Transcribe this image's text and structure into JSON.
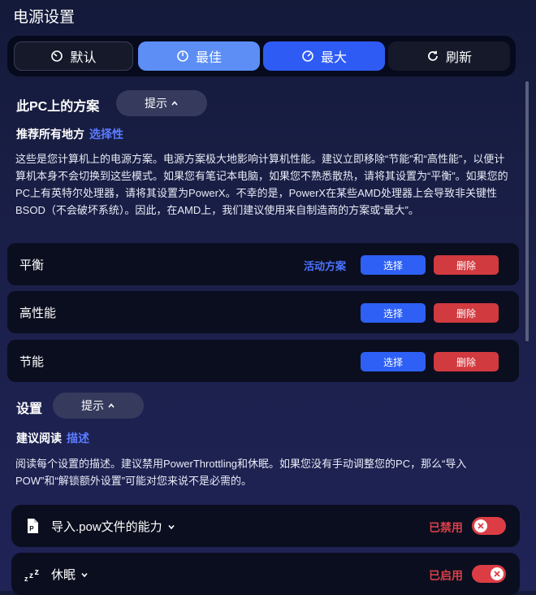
{
  "window": {
    "title": "电源设置"
  },
  "modes": [
    {
      "label": "默认",
      "icon": "gauge-low-icon"
    },
    {
      "label": "最佳",
      "icon": "gauge-mid-icon"
    },
    {
      "label": "最大",
      "icon": "gauge-high-icon"
    },
    {
      "label": "刷新",
      "icon": "refresh-icon"
    }
  ],
  "plans_section": {
    "heading": "此PC上的方案",
    "tip_label": "提示",
    "sub_heading": "推荐所有地方",
    "sub_accent": "选择性",
    "description": "这些是您计算机上的电源方案。电源方案极大地影响计算机性能。建议立即移除“节能”和“高性能”，以便计算机本身不会切换到这些模式。如果您有笔记本电脑，如果您不熟悉散热，请将其设置为“平衡”。如果您的PC上有英特尔处理器，请将其设置为PowerX。不幸的是，PowerX在某些AMD处理器上会导致非关键性BSOD（不会破坏系统）。因此，在AMD上，我们建议使用来自制造商的方案或“最大”。",
    "active_label": "活动方案",
    "select_label": "选择",
    "delete_label": "删除",
    "plans": [
      {
        "name": "平衡"
      },
      {
        "name": "高性能"
      },
      {
        "name": "节能"
      }
    ]
  },
  "settings_section": {
    "heading": "设置",
    "tip_label": "提示",
    "sub_heading": "建议阅读",
    "sub_accent": "描述",
    "description": "阅读每个设置的描述。建议禁用PowerThrottling和休眠。如果您没有手动调整您的PC，那么“导入POW”和“解锁额外设置”可能对您来说不是必需的。",
    "items": [
      {
        "label": "导入.pow文件的能力",
        "status": "已禁用",
        "icon": "pow-file-icon",
        "enabled": false
      },
      {
        "label": "休眠",
        "status": "已启用",
        "icon": "sleep-zzz-icon",
        "enabled": true
      }
    ]
  },
  "colors": {
    "accent": "#2f5bf5",
    "danger": "#d13a3f",
    "background": "#141a3a"
  }
}
